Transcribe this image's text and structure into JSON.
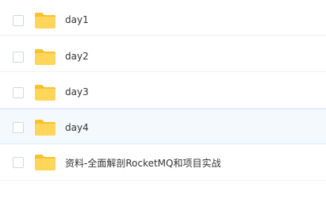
{
  "colors": {
    "folder_body": "#ffd659",
    "folder_tab": "#f5c230",
    "row_hover_bg": "#f4f9fd",
    "row_divider": "#eef1f6",
    "text": "#333333"
  },
  "file_list": {
    "items": [
      {
        "name": "day1",
        "icon": "folder-icon",
        "selected": false
      },
      {
        "name": "day2",
        "icon": "folder-icon",
        "selected": false
      },
      {
        "name": "day3",
        "icon": "folder-icon",
        "selected": false
      },
      {
        "name": "day4",
        "icon": "folder-icon",
        "selected": false,
        "hovered": true
      },
      {
        "name": "资料-全面解剖RocketMQ和项目实战",
        "icon": "folder-icon",
        "selected": false
      }
    ]
  }
}
